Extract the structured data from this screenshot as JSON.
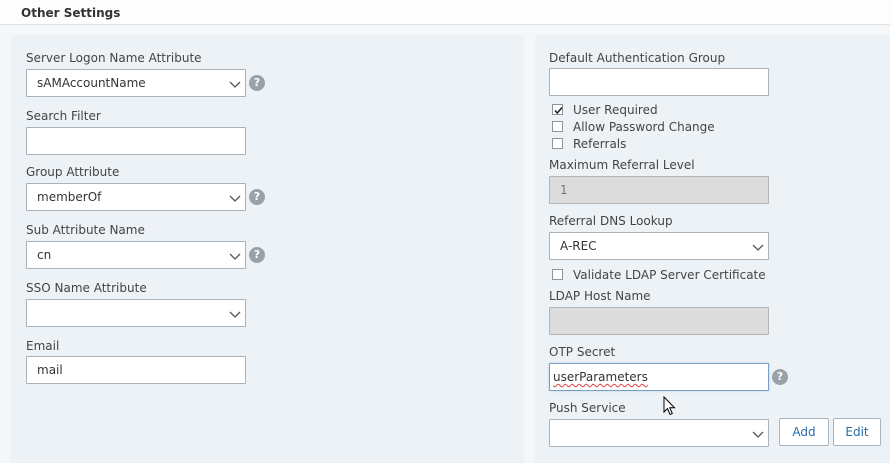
{
  "section": {
    "title": "Other Settings"
  },
  "left_panel": {
    "server_logon": {
      "label": "Server Logon Name Attribute",
      "value": "sAMAccountName"
    },
    "search_filter": {
      "label": "Search Filter",
      "value": ""
    },
    "group_attribute": {
      "label": "Group Attribute",
      "value": "memberOf"
    },
    "sub_attribute": {
      "label": "Sub Attribute Name",
      "value": "cn"
    },
    "sso_name": {
      "label": "SSO Name Attribute",
      "value": ""
    },
    "email": {
      "label": "Email",
      "value": "mail"
    }
  },
  "right_panel": {
    "default_auth_group": {
      "label": "Default Authentication Group",
      "value": ""
    },
    "user_required": {
      "label": "User Required",
      "checked": true
    },
    "allow_password_change": {
      "label": "Allow Password Change",
      "checked": false
    },
    "referrals": {
      "label": "Referrals",
      "checked": false
    },
    "max_referral_level": {
      "label": "Maximum Referral Level",
      "value": "1"
    },
    "referral_dns_lookup": {
      "label": "Referral DNS Lookup",
      "value": "A-REC"
    },
    "validate_ldap_cert": {
      "label": "Validate LDAP Server Certificate",
      "checked": false
    },
    "ldap_host_name": {
      "label": "LDAP Host Name",
      "value": ""
    },
    "otp_secret": {
      "label": "OTP Secret",
      "value": "userParameters"
    },
    "push_service": {
      "label": "Push Service",
      "value": ""
    },
    "add_label": "Add",
    "edit_label": "Edit"
  },
  "help_glyph": "?",
  "colors": {
    "panel_bg": "#edf2f6",
    "link_blue": "#2b6ca3",
    "help_gray": "#9aa1a8"
  }
}
